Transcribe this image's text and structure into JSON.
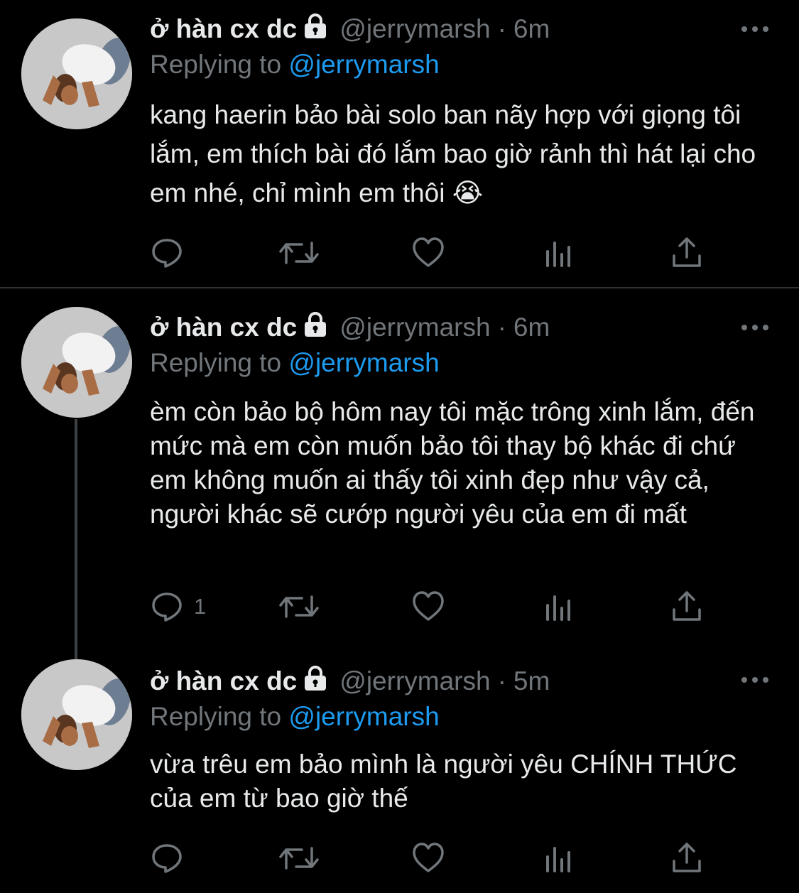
{
  "tweets": [
    {
      "display_name": "ở hàn cx dc",
      "handle": "@jerrymarsh",
      "dot": "·",
      "time": "6m",
      "replying_prefix": "Replying to",
      "replying_to": "@jerrymarsh",
      "text": "kang haerin bảo bài solo ban nãy hợp với giọng tôi lắm, em thích bài đó lắm bao giờ rảnh thì hát lại cho em nhé, chỉ mình em thôi 😭",
      "reply_count": ""
    },
    {
      "display_name": "ở hàn cx dc",
      "handle": "@jerrymarsh",
      "dot": "·",
      "time": "6m",
      "replying_prefix": "Replying to",
      "replying_to": "@jerrymarsh",
      "text": "èm còn bảo bộ hôm nay tôi mặc trông xinh lắm, đến mức mà em còn muốn bảo tôi thay bộ khác đi chứ em không muốn ai thấy tôi xinh đẹp như vậy cả, người khác sẽ cướp người yêu của em đi mất",
      "reply_count": "1"
    },
    {
      "display_name": "ở hàn cx dc",
      "handle": "@jerrymarsh",
      "dot": "·",
      "time": "5m",
      "replying_prefix": "Replying to",
      "replying_to": "@jerrymarsh",
      "text": "vừa trêu em bảo mình là người yêu CHÍNH THỨC của em từ bao giờ thế",
      "reply_count": ""
    }
  ],
  "colors": {
    "background": "#000000",
    "text": "#e7e9ea",
    "secondary": "#71767b",
    "mention": "#1d9bf0",
    "divider": "#2f3336"
  },
  "icons": [
    "lock-icon",
    "more-icon",
    "reply-icon",
    "retweet-icon",
    "like-icon",
    "views-icon",
    "share-icon"
  ]
}
